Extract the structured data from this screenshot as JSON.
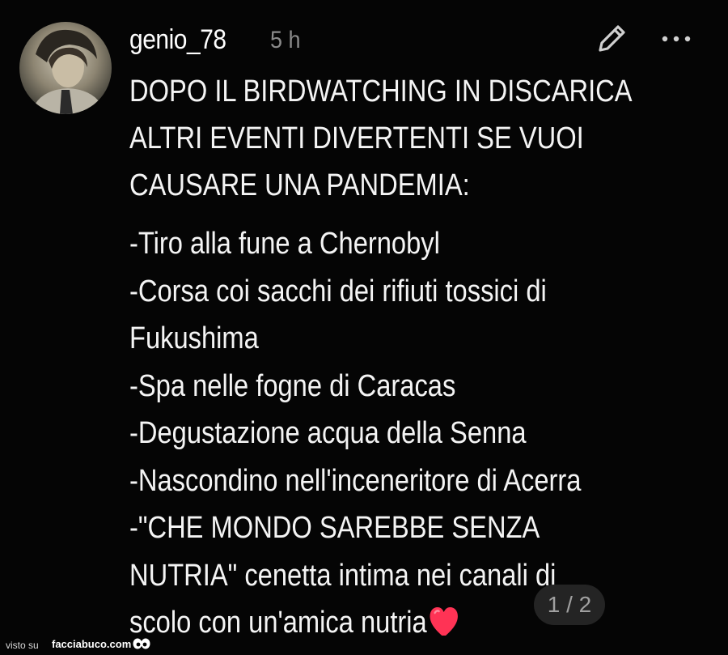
{
  "post": {
    "username": "genio_78",
    "time": "5 h",
    "headline": [
      "DOPO IL BIRDWATCHING IN DISCARICA",
      "ALTRI EVENTI DIVERTENTI SE VUOI",
      "CAUSARE UNA PANDEMIA:"
    ],
    "lines": [
      "-Tiro alla fune a Chernobyl",
      "-Corsa coi sacchi dei rifiuti tossici di",
      "Fukushima",
      "-Spa nelle fogne di Caracas",
      "-Degustazione acqua della Senna",
      "-Nascondino nell'inceneritore di Acerra",
      "-\"CHE MONDO SAREBBE SENZA",
      "NUTRIA\" cenetta intima nei canali di",
      "scolo con un'amica nutria"
    ],
    "pager": "1 / 2",
    "icons": {
      "edit": "pencil-icon",
      "more": "more-horizontal-icon",
      "heart": "heart-icon"
    },
    "colors": {
      "background": "#050505",
      "text": "#f4f4f4",
      "muted": "#8a8a8a",
      "heart": "#ff3355"
    }
  },
  "footer": {
    "visto": "visto su",
    "site": "facciabuco.com"
  }
}
